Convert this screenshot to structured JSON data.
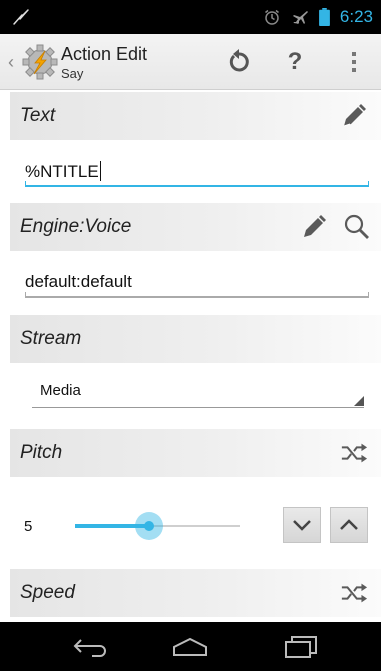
{
  "status_bar": {
    "time": "6:23",
    "icons": [
      "tasker-bolt-icon",
      "alarm-icon",
      "airplane-icon",
      "battery-icon"
    ]
  },
  "action_bar": {
    "title": "Action Edit",
    "subtitle": "Say",
    "help_label": "?",
    "icons": [
      "back-caret-icon",
      "tasker-app-icon",
      "reset-icon",
      "overflow-menu-icon"
    ]
  },
  "text_section": {
    "label": "Text",
    "value": "%NTITLE",
    "icons": [
      "edit-pencil-icon"
    ]
  },
  "engine_section": {
    "label": "Engine:Voice",
    "value": "default:default",
    "icons": [
      "edit-pencil-icon",
      "search-icon"
    ]
  },
  "stream_section": {
    "label": "Stream",
    "selected": "Media"
  },
  "pitch_section": {
    "label": "Pitch",
    "value": "5",
    "slider_fraction": 0.45,
    "icons": [
      "shuffle-icon",
      "chevron-down-icon",
      "chevron-up-icon"
    ]
  },
  "speed_section": {
    "label": "Speed",
    "icons": [
      "shuffle-icon"
    ]
  },
  "nav_bar": {
    "icons": [
      "back-icon",
      "home-icon",
      "recents-icon"
    ]
  },
  "colors": {
    "accent": "#33b5e5",
    "header_bg": "#e8e8e8",
    "icon_gray": "#5a5a5a"
  }
}
